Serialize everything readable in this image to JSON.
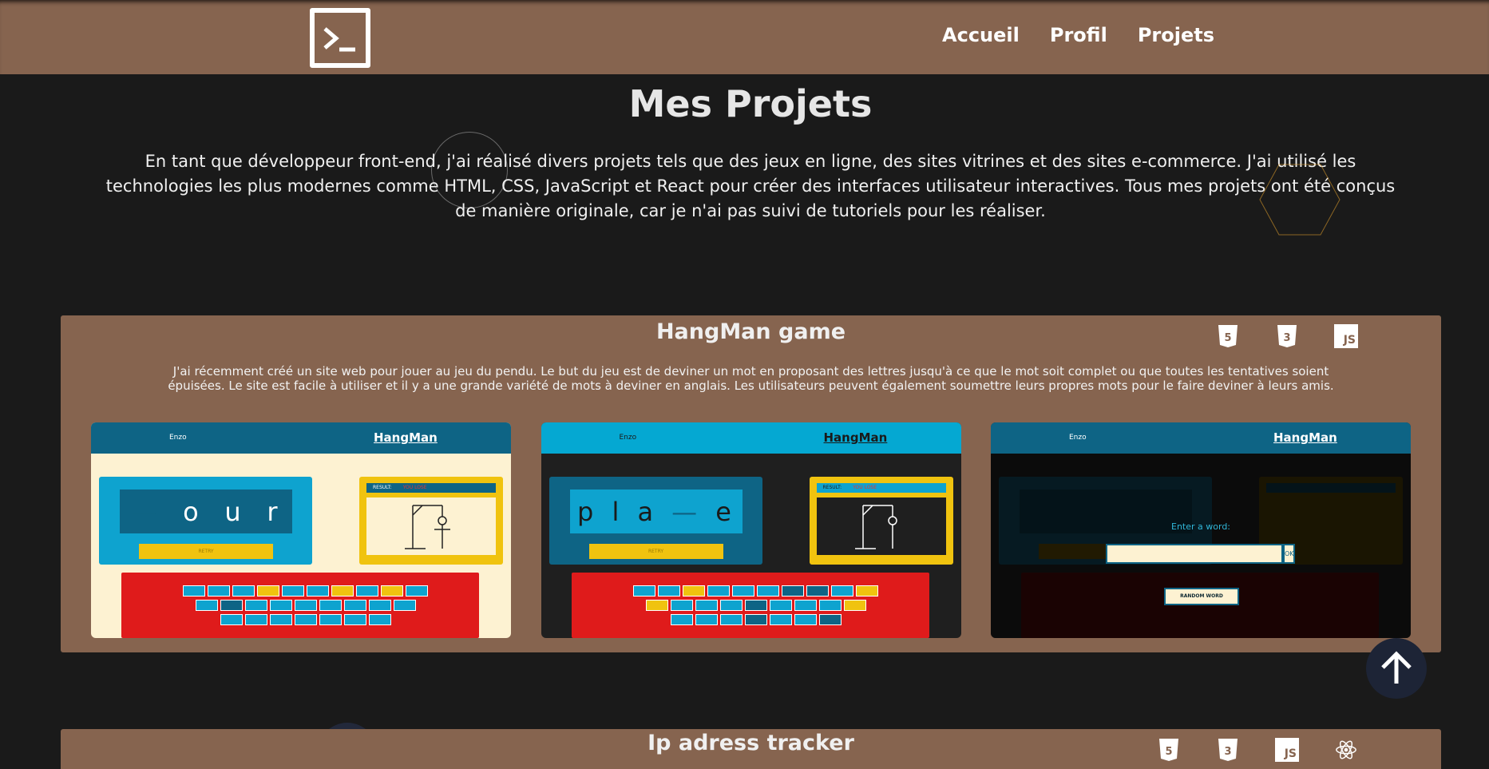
{
  "header": {
    "nav": [
      "Accueil",
      "Profil",
      "Projets"
    ]
  },
  "page": {
    "title": "Mes Projets",
    "intro": "En tant que développeur front-end, j'ai réalisé divers projets tels que des jeux en ligne, des sites vitrines et des sites e-commerce. J'ai utilisé les technologies les plus modernes comme HTML, CSS, JavaScript et React pour créer des interfaces utilisateur interactives. Tous mes projets ont été conçus de manière originale, car je n'ai pas suivi de tutoriels pour les réaliser."
  },
  "projects": [
    {
      "title": "HangMan game",
      "tech": [
        "html5-icon",
        "css3-icon",
        "js-icon"
      ],
      "js_label": "JS",
      "description": "J'ai récemment créé un site web pour jouer au jeu du pendu. Le but du jeu est de deviner un mot en proposant des lettres jusqu'à ce que le mot soit complet ou que toutes les tentatives soient épuisées. Le site est facile à utiliser et il y a une grande variété de mots à deviner en anglais. Les utilisateurs peuvent également soumettre leurs propres mots pour le faire deviner à leurs amis.",
      "screenshots": {
        "author": "Enzo",
        "game_name": "HangMan",
        "shot1_word": [
          "—",
          "o",
          "u",
          "r"
        ],
        "shot2_word": [
          "p",
          "l",
          "a",
          "—",
          "e"
        ],
        "retry_label": "RETRY",
        "result_label": "RESULT:",
        "result_value": "YOU LOSE",
        "enter_label": "Enter a word:",
        "ok_label": "OK",
        "random_label": "RANDOM WORD"
      }
    },
    {
      "title": "Ip adress tracker",
      "tech": [
        "html5-icon",
        "css3-icon",
        "js-icon",
        "react-icon"
      ],
      "js_label": "JS"
    }
  ],
  "colors": {
    "header_bg": "#86644f",
    "page_bg": "#1a1a1a",
    "card_bg": "#86644f",
    "hangman_blue": "#0e6485",
    "hangman_cyan": "#05a8d2",
    "hangman_yellow": "#f0c30f",
    "hangman_red": "#df1b1b",
    "hangman_cream": "#fdf2d2"
  },
  "icons": {
    "logo": "terminal-prompt-icon",
    "scroll_top": "arrow-up-icon"
  }
}
